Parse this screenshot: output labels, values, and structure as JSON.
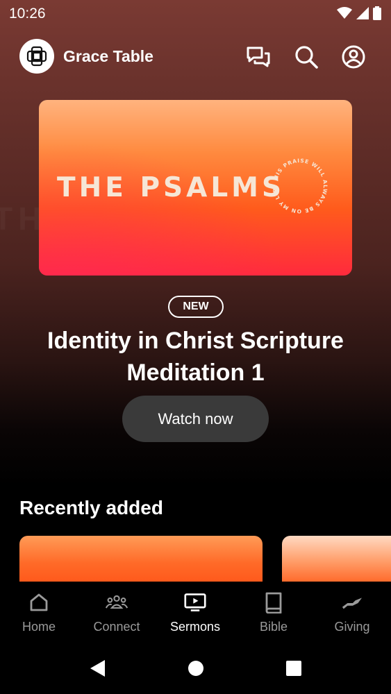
{
  "status_bar": {
    "time": "10:26"
  },
  "header": {
    "app_title": "Grace Table"
  },
  "hero": {
    "art_title": "THE PSALMS",
    "art_circle_text": "HIS PRAISE WILL ALWAYS BE ON MY LIPS",
    "badge": "NEW",
    "title": "Identity in Christ Scripture Meditation 1",
    "button_label": "Watch now"
  },
  "recent": {
    "title": "Recently added"
  },
  "bottom_nav": {
    "items": [
      {
        "label": "Home",
        "icon": "home-icon"
      },
      {
        "label": "Connect",
        "icon": "people-icon"
      },
      {
        "label": "Sermons",
        "icon": "tv-icon",
        "active": true
      },
      {
        "label": "Bible",
        "icon": "book-icon"
      },
      {
        "label": "Giving",
        "icon": "hand-icon"
      }
    ]
  },
  "colors": {
    "accent": "#ff5b1c",
    "button_bg": "#3a3a3a",
    "nav_inactive": "#9a9a9a"
  }
}
